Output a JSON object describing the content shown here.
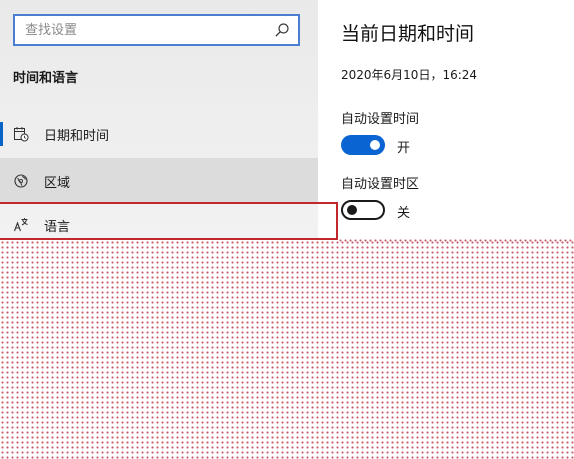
{
  "search": {
    "placeholder": "查找设置"
  },
  "sidebar": {
    "section_title": "时间和语言",
    "items": [
      {
        "label": "日期和时间",
        "icon": "calendar-clock-icon"
      },
      {
        "label": "区域",
        "icon": "globe-icon"
      },
      {
        "label": "语言",
        "icon": "language-icon"
      }
    ]
  },
  "main": {
    "title": "当前日期和时间",
    "datetime": "2020年6月10日，16:24",
    "auto_time": {
      "label": "自动设置时间",
      "state": "开"
    },
    "auto_zone": {
      "label": "自动设置时区",
      "state": "关"
    }
  },
  "colors": {
    "accent": "#0a64d2",
    "highlight_border": "#c0282d",
    "search_border": "#4a7ed0"
  }
}
